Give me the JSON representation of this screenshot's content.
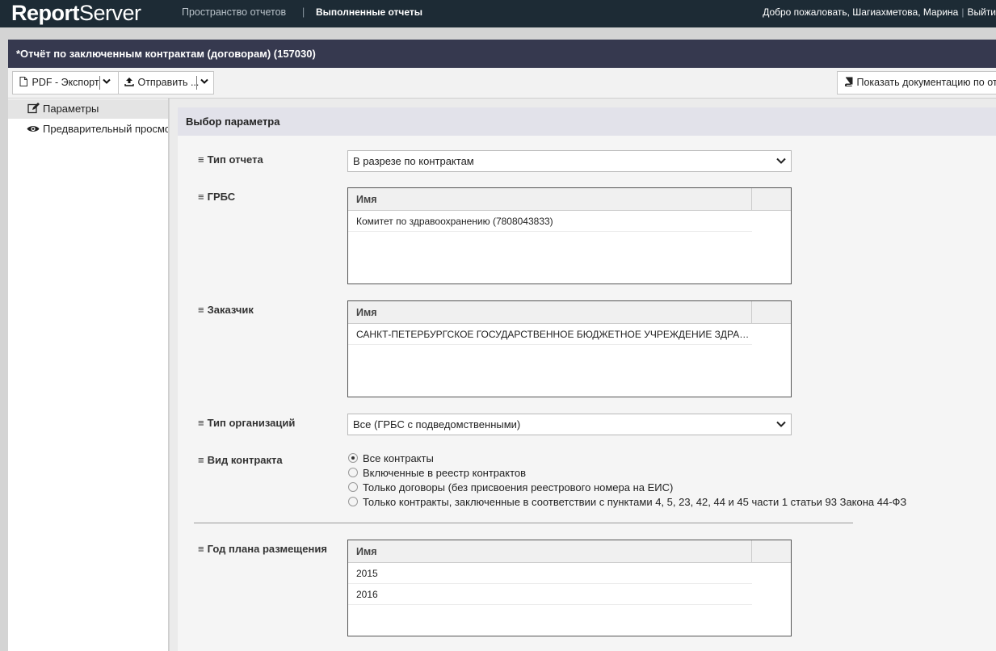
{
  "nav": {
    "logo_bold": "Report",
    "logo_rest": "Server",
    "spaces": "Пространство отчетов",
    "separator": "|",
    "completed": "Выполненные отчеты",
    "welcome": "Добро пожаловать, Шагиахметова, Марина",
    "logout": "Выйти"
  },
  "report": {
    "title": "*Отчёт по заключенным контрактам (договорам) (157030)"
  },
  "toolbar": {
    "pdf_export_label": "PDF - Экспорт",
    "send_label": "Отправить ...",
    "docs_label": "Показать документацию по отчету"
  },
  "sidebar": {
    "items": [
      {
        "label": "Параметры",
        "icon": "edit-icon"
      },
      {
        "label": "Предварительный просмотр",
        "icon": "eye-icon"
      }
    ]
  },
  "main": {
    "section_title": "Выбор параметра",
    "params": {
      "report_type": {
        "label": "Тип отчета",
        "value": "В разрезе по контрактам"
      },
      "grbs": {
        "label": "ГРБС",
        "column": "Имя",
        "rows": [
          "Комитет по здравоохранению (7808043833)"
        ]
      },
      "customer": {
        "label": "Заказчик",
        "column": "Имя",
        "rows": [
          "САНКТ-ПЕТЕРБУРГСКОЕ ГОСУДАРСТВЕННОЕ БЮДЖЕТНОЕ УЧРЕЖДЕНИЕ ЗДРАВООХРАНЕНИЯ"
        ]
      },
      "org_type": {
        "label": "Тип организаций",
        "value": "Все (ГРБС с подведомственными)"
      },
      "contract_kind": {
        "label": "Вид контракта",
        "options": [
          "Все контракты",
          "Включенные в реестр контрактов",
          "Только договоры (без присвоения реестрового номера на ЕИС)",
          "Только контракты, заключенные в соответствии с пунктами 4, 5, 23, 42, 44 и 45 части 1 статьи 93 Закона 44-ФЗ"
        ],
        "selected_index": 0
      },
      "plan_year": {
        "label": "Год плана размещения",
        "column": "Имя",
        "rows": [
          "2015",
          "2016"
        ]
      }
    }
  }
}
